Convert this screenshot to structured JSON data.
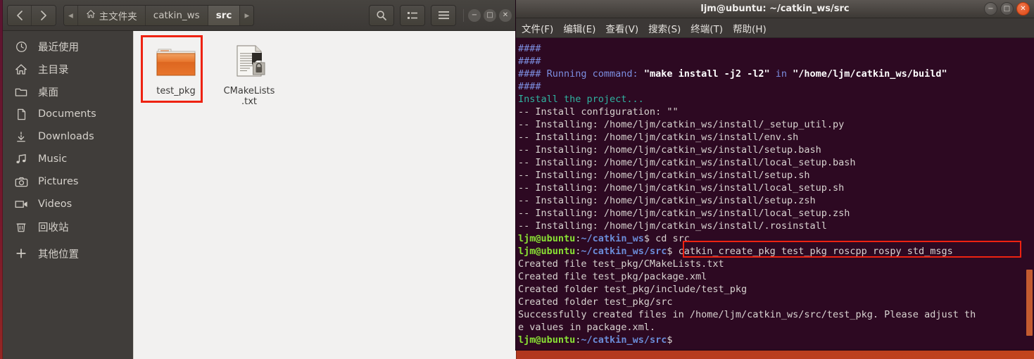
{
  "file_manager": {
    "nav": {
      "back_label": "‹",
      "forward_label": "›"
    },
    "breadcrumb": {
      "prev_arrow": "◂",
      "next_arrow": "▸",
      "items": [
        {
          "label": "主文件夹",
          "icon": "home-icon",
          "active": false
        },
        {
          "label": "catkin_ws",
          "icon": "",
          "active": false
        },
        {
          "label": "src",
          "icon": "",
          "active": true
        }
      ]
    },
    "toolbar": {
      "search_icon": "search-icon",
      "view_icon": "list-view-icon",
      "menu_icon": "hamburger-menu-icon"
    },
    "window_controls": {
      "minimize": "−",
      "maximize": "□",
      "close": "✕"
    },
    "sidebar": {
      "items": [
        {
          "label": "最近使用",
          "icon": "clock-icon"
        },
        {
          "label": "主目录",
          "icon": "home-icon"
        },
        {
          "label": "桌面",
          "icon": "folder-icon"
        },
        {
          "label": "Documents",
          "icon": "document-icon"
        },
        {
          "label": "Downloads",
          "icon": "download-icon"
        },
        {
          "label": "Music",
          "icon": "music-icon"
        },
        {
          "label": "Pictures",
          "icon": "camera-icon"
        },
        {
          "label": "Videos",
          "icon": "video-icon"
        },
        {
          "label": "回收站",
          "icon": "trash-icon"
        },
        {
          "label": "其他位置",
          "icon": "plus-icon"
        }
      ]
    },
    "files": [
      {
        "name": "test_pkg",
        "type": "folder",
        "highlighted": true
      },
      {
        "name": "CMakeLists\n.txt",
        "type": "text-file",
        "highlighted": false
      }
    ],
    "colors": {
      "annotation": "#ee2211",
      "folder": "#e8762d",
      "sidebar_bg": "#403d3a"
    }
  },
  "terminal": {
    "title": "ljm@ubuntu: ~/catkin_ws/src",
    "window_controls": {
      "minimize": "−",
      "maximize": "□",
      "close": "✕"
    },
    "menu": [
      "文件(F)",
      "编辑(E)",
      "查看(V)",
      "搜索(S)",
      "终端(T)",
      "帮助(H)"
    ],
    "colors": {
      "background": "#2d0922",
      "prompt_user": "#8ae234",
      "prompt_path": "#6b8cd8",
      "info": "#7c8ee0",
      "teal": "#2fb2a0",
      "scrollbar": "#c35b30"
    },
    "lines": [
      {
        "segs": [
          {
            "t": "####",
            "c": "c-hash"
          }
        ]
      },
      {
        "segs": [
          {
            "t": "####",
            "c": "c-hash"
          }
        ]
      },
      {
        "segs": [
          {
            "t": "#### Running command: ",
            "c": "c-blue"
          },
          {
            "t": "\"make install -j2 -l2\"",
            "c": "c-white"
          },
          {
            "t": " in ",
            "c": "c-blue"
          },
          {
            "t": "\"/home/ljm/catkin_ws/build\"",
            "c": "c-white"
          }
        ]
      },
      {
        "segs": [
          {
            "t": "####",
            "c": "c-hash"
          }
        ]
      },
      {
        "segs": [
          {
            "t": "Install the project...",
            "c": "c-teal"
          }
        ]
      },
      {
        "segs": [
          {
            "t": "-- Install configuration: \"\"",
            "c": "c-plain"
          }
        ]
      },
      {
        "segs": [
          {
            "t": "-- Installing: /home/ljm/catkin_ws/install/_setup_util.py",
            "c": "c-plain"
          }
        ]
      },
      {
        "segs": [
          {
            "t": "-- Installing: /home/ljm/catkin_ws/install/env.sh",
            "c": "c-plain"
          }
        ]
      },
      {
        "segs": [
          {
            "t": "-- Installing: /home/ljm/catkin_ws/install/setup.bash",
            "c": "c-plain"
          }
        ]
      },
      {
        "segs": [
          {
            "t": "-- Installing: /home/ljm/catkin_ws/install/local_setup.bash",
            "c": "c-plain"
          }
        ]
      },
      {
        "segs": [
          {
            "t": "-- Installing: /home/ljm/catkin_ws/install/setup.sh",
            "c": "c-plain"
          }
        ]
      },
      {
        "segs": [
          {
            "t": "-- Installing: /home/ljm/catkin_ws/install/local_setup.sh",
            "c": "c-plain"
          }
        ]
      },
      {
        "segs": [
          {
            "t": "-- Installing: /home/ljm/catkin_ws/install/setup.zsh",
            "c": "c-plain"
          }
        ]
      },
      {
        "segs": [
          {
            "t": "-- Installing: /home/ljm/catkin_ws/install/local_setup.zsh",
            "c": "c-plain"
          }
        ]
      },
      {
        "segs": [
          {
            "t": "-- Installing: /home/ljm/catkin_ws/install/.rosinstall",
            "c": "c-plain"
          }
        ]
      },
      {
        "segs": [
          {
            "t": "ljm@ubuntu",
            "c": "c-green"
          },
          {
            "t": ":",
            "c": "c-plain"
          },
          {
            "t": "~/catkin_ws",
            "c": "c-pblue"
          },
          {
            "t": "$ cd src",
            "c": "c-plain"
          }
        ]
      },
      {
        "segs": [
          {
            "t": "ljm@ubuntu",
            "c": "c-green"
          },
          {
            "t": ":",
            "c": "c-plain"
          },
          {
            "t": "~/catkin_ws/src",
            "c": "c-pblue"
          },
          {
            "t": "$ catkin_create_pkg test_pkg roscpp rospy std_msgs",
            "c": "c-plain"
          }
        ]
      },
      {
        "segs": [
          {
            "t": "Created file test_pkg/CMakeLists.txt",
            "c": "c-plain"
          }
        ]
      },
      {
        "segs": [
          {
            "t": "Created file test_pkg/package.xml",
            "c": "c-plain"
          }
        ]
      },
      {
        "segs": [
          {
            "t": "Created folder test_pkg/include/test_pkg",
            "c": "c-plain"
          }
        ]
      },
      {
        "segs": [
          {
            "t": "Created folder test_pkg/src",
            "c": "c-plain"
          }
        ]
      },
      {
        "segs": [
          {
            "t": "Successfully created files in /home/ljm/catkin_ws/src/test_pkg. Please adjust th",
            "c": "c-plain"
          }
        ]
      },
      {
        "segs": [
          {
            "t": "e values in package.xml.",
            "c": "c-plain"
          }
        ]
      },
      {
        "segs": [
          {
            "t": "ljm@ubuntu",
            "c": "c-green"
          },
          {
            "t": ":",
            "c": "c-plain"
          },
          {
            "t": "~/catkin_ws/src",
            "c": "c-pblue"
          },
          {
            "t": "$",
            "c": "c-plain"
          }
        ]
      }
    ]
  }
}
